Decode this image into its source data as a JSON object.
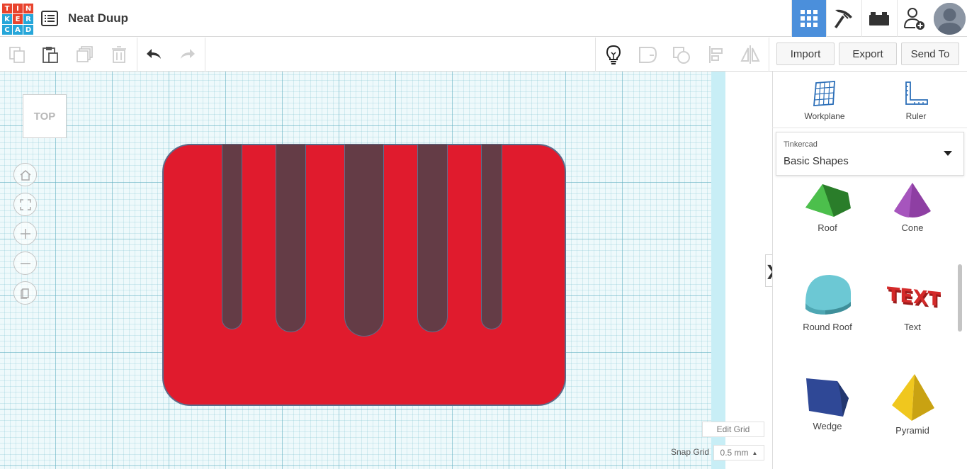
{
  "header": {
    "logo_letters": [
      "T",
      "I",
      "N",
      "K",
      "E",
      "R",
      "C",
      "A",
      "D"
    ],
    "logo_colors": [
      "#e8432d",
      "#e8432d",
      "#e8432d",
      "#26a6d9",
      "#e8432d",
      "#26a6d9",
      "#26a6d9",
      "#26a6d9",
      "#26a6d9"
    ],
    "design_title": "Neat Duup",
    "nav_icons": [
      "grid-view-icon",
      "pickaxe-icon",
      "bricks-icon",
      "add-user-icon"
    ],
    "active_nav": "grid-view-icon",
    "accent_color": "#4b8fdb"
  },
  "toolbar": {
    "icons": [
      "copy-icon",
      "paste-icon",
      "duplicate-icon",
      "delete-icon",
      "undo-icon",
      "redo-icon",
      "lightbulb-icon",
      "group-icon",
      "ungroup-icon",
      "align-icon",
      "mirror-icon"
    ],
    "import_label": "Import",
    "export_label": "Export",
    "send_to_label": "Send To"
  },
  "workplane": {
    "view_cube_label": "TOP",
    "view_controls": [
      "home-icon",
      "fit-icon",
      "zoom-in-icon",
      "zoom-out-icon",
      "perspective-icon"
    ],
    "shape_color": "#e01b2d",
    "hole_color": "#643c46",
    "edit_grid_label": "Edit Grid",
    "snap_grid_label": "Snap Grid",
    "snap_grid_value": "0.5 mm"
  },
  "right_panel": {
    "workplane_label": "Workplane",
    "ruler_label": "Ruler",
    "category_source": "Tinkercad",
    "category_name": "Basic Shapes",
    "shapes": [
      {
        "label": "Roof",
        "color": "#3aa13a"
      },
      {
        "label": "Cone",
        "color": "#8e3fa3"
      },
      {
        "label": "Round Roof",
        "color": "#6cc8d4"
      },
      {
        "label": "Text",
        "color": "#d42a2a"
      },
      {
        "label": "Wedge",
        "color": "#2f4896"
      },
      {
        "label": "Pyramid",
        "color": "#f0c71e"
      }
    ]
  }
}
